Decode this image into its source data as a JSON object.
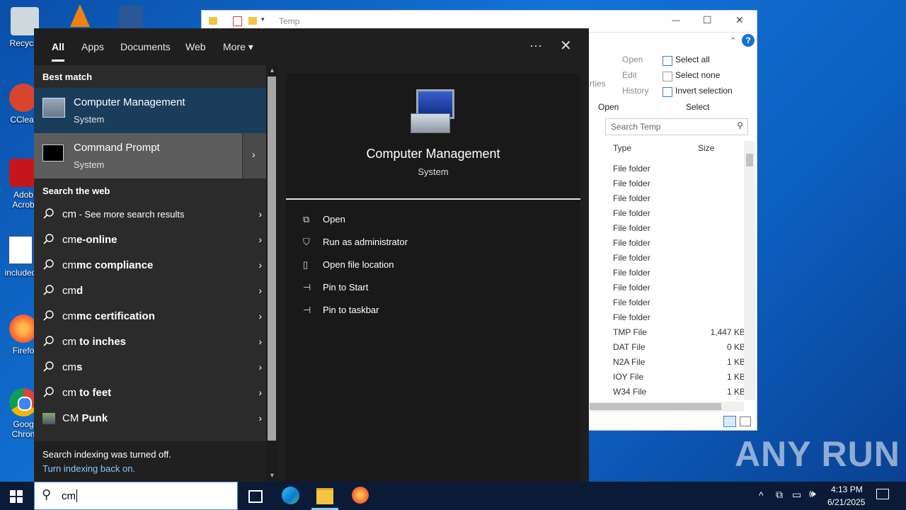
{
  "desktop": {
    "icons": [
      {
        "label": "Recycle"
      },
      {
        "label": "CClear"
      },
      {
        "label": "Adob Acrob"
      },
      {
        "label": "included"
      },
      {
        "label": "Firefo"
      },
      {
        "label": "Goog Chron"
      }
    ]
  },
  "explorer": {
    "title": "Temp",
    "window_controls": {
      "minimize": "—",
      "maximize": "☐",
      "close": "✕"
    },
    "ribbon": {
      "open_group": {
        "open": "Open",
        "edit": "Edit",
        "history": "History",
        "label": "Open",
        "partial": "rties"
      },
      "select_group": {
        "select_all": "Select all",
        "select_none": "Select none",
        "invert": "Invert selection",
        "label": "Select"
      }
    },
    "search_placeholder": "Search Temp",
    "columns": {
      "type": "Type",
      "size": "Size"
    },
    "rows": [
      {
        "type": "File folder",
        "size": ""
      },
      {
        "type": "File folder",
        "size": ""
      },
      {
        "type": "File folder",
        "size": ""
      },
      {
        "type": "File folder",
        "size": ""
      },
      {
        "type": "File folder",
        "size": ""
      },
      {
        "type": "File folder",
        "size": ""
      },
      {
        "type": "File folder",
        "size": ""
      },
      {
        "type": "File folder",
        "size": ""
      },
      {
        "type": "File folder",
        "size": ""
      },
      {
        "type": "File folder",
        "size": ""
      },
      {
        "type": "File folder",
        "size": ""
      },
      {
        "type": "TMP File",
        "size": "1,447 KB"
      },
      {
        "type": "DAT File",
        "size": "0 KB"
      },
      {
        "type": "N2A File",
        "size": "1 KB"
      },
      {
        "type": "IOY File",
        "size": "1 KB"
      },
      {
        "type": "W34 File",
        "size": "1 KB"
      }
    ]
  },
  "start": {
    "tabs": [
      {
        "label": "All"
      },
      {
        "label": "Apps"
      },
      {
        "label": "Documents"
      },
      {
        "label": "Web"
      },
      {
        "label": "More"
      }
    ],
    "more_icon": "ellipsis-icon",
    "close_icon": "close-icon",
    "best_match_heading": "Best match",
    "best_match": [
      {
        "title": "Computer Management",
        "subtitle": "System"
      },
      {
        "title": "Command Prompt",
        "subtitle": "System"
      }
    ],
    "web_heading": "Search the web",
    "web_results": [
      {
        "prefix": "cm",
        "bold": "",
        "suffix": " - See more search results"
      },
      {
        "prefix": "cm",
        "bold": "e-online",
        "suffix": ""
      },
      {
        "prefix": "cm",
        "bold": "mc compliance",
        "suffix": ""
      },
      {
        "prefix": "cm",
        "bold": "d",
        "suffix": ""
      },
      {
        "prefix": "cm",
        "bold": "mc certification",
        "suffix": ""
      },
      {
        "prefix": "cm",
        "bold": " to inches",
        "suffix": ""
      },
      {
        "prefix": "cm",
        "bold": "s",
        "suffix": ""
      },
      {
        "prefix": "cm",
        "bold": " to feet",
        "suffix": ""
      },
      {
        "prefix": "CM",
        "bold": " Punk",
        "suffix": ""
      }
    ],
    "footer": {
      "line1": "Search indexing was turned off.",
      "link": "Turn indexing back on."
    },
    "preview": {
      "title": "Computer Management",
      "subtitle": "System",
      "actions": [
        {
          "label": "Open",
          "icon": "open-icon"
        },
        {
          "label": "Run as administrator",
          "icon": "shield-icon"
        },
        {
          "label": "Open file location",
          "icon": "file-location-icon"
        },
        {
          "label": "Pin to Start",
          "icon": "pin-icon"
        },
        {
          "label": "Pin to taskbar",
          "icon": "pin-icon"
        }
      ]
    }
  },
  "taskbar": {
    "search_value": "cm",
    "time": "4:13 PM",
    "date": "6/21/2025"
  },
  "watermark": "ANY RUN"
}
